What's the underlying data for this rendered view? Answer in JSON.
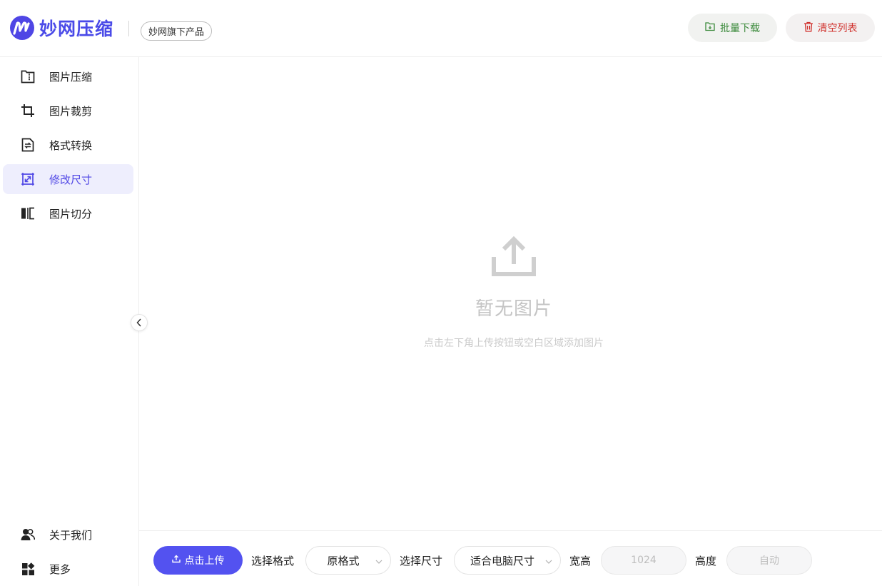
{
  "header": {
    "logo_text": "妙网压缩",
    "brand_badge": "妙网旗下产品",
    "batch_download": "批量下载",
    "clear_list": "清空列表"
  },
  "sidebar": {
    "items": [
      {
        "label": "图片压缩",
        "icon": "compress-icon"
      },
      {
        "label": "图片裁剪",
        "icon": "crop-icon"
      },
      {
        "label": "格式转换",
        "icon": "convert-icon"
      },
      {
        "label": "修改尺寸",
        "icon": "resize-icon",
        "active": true
      },
      {
        "label": "图片切分",
        "icon": "split-icon"
      }
    ],
    "bottom_items": [
      {
        "label": "关于我们",
        "icon": "users-icon"
      },
      {
        "label": "更多",
        "icon": "apps-icon"
      }
    ]
  },
  "empty_state": {
    "title": "暂无图片",
    "subtitle": "点击左下角上传按钮或空白区域添加图片"
  },
  "toolbar": {
    "upload_label": "点击上传",
    "format_label": "选择格式",
    "format_value": "原格式",
    "size_label": "选择尺寸",
    "size_value": "适合电脑尺寸",
    "width_label": "宽高",
    "width_value": "1024",
    "height_label": "高度",
    "height_value": "自动"
  },
  "colors": {
    "accent": "#5352f0",
    "active_bg": "#eeeefd",
    "batch_text": "#3b8a3b",
    "clear_text": "#d0312d"
  }
}
